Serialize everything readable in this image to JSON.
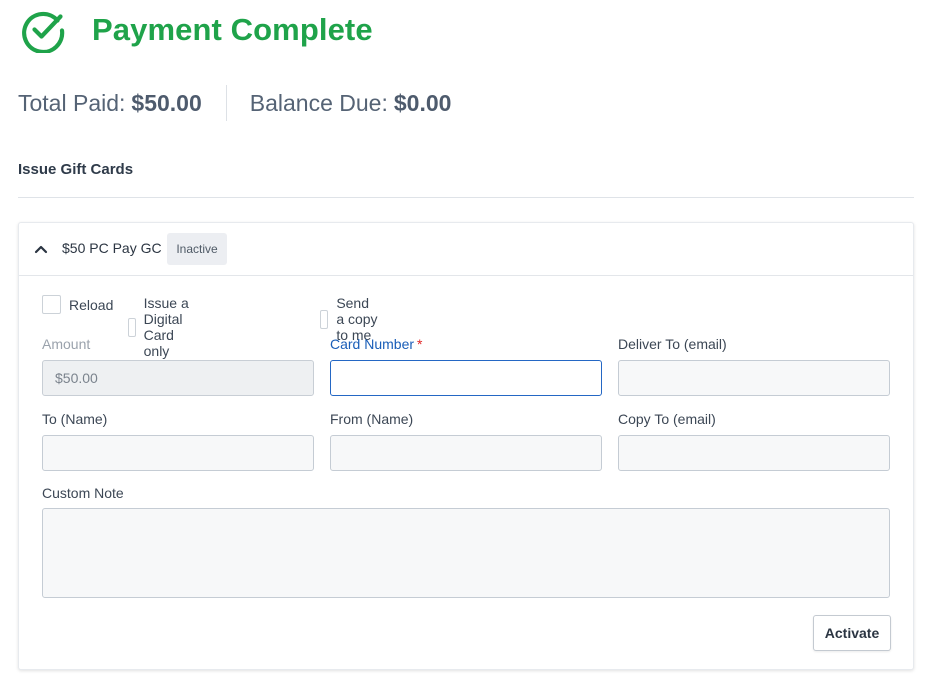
{
  "header": {
    "title": "Payment Complete",
    "icon": "check-circle-icon",
    "accent_color": "#1fa34a"
  },
  "totals": {
    "paid_label": "Total Paid:",
    "paid_amount": "$50.00",
    "due_label": "Balance Due:",
    "due_amount": "$0.00"
  },
  "section": {
    "title": "Issue Gift Cards"
  },
  "gift_card": {
    "name": "$50 PC Pay GC",
    "status": "Inactive",
    "expanded": true,
    "options": {
      "reload": "Reload",
      "digital_only": "Issue a Digital Card only",
      "send_copy": "Send a copy to me"
    },
    "fields": {
      "amount_label": "Amount",
      "amount_value": "$50.00",
      "card_number_label": "Card Number",
      "card_number_required": "*",
      "card_number_value": "",
      "deliver_to_label": "Deliver To (email)",
      "deliver_to_value": "",
      "to_name_label": "To (Name)",
      "to_name_value": "",
      "from_name_label": "From (Name)",
      "from_name_value": "",
      "copy_to_label": "Copy To (email)",
      "copy_to_value": "",
      "custom_note_label": "Custom Note",
      "custom_note_value": ""
    },
    "activate_label": "Activate"
  }
}
